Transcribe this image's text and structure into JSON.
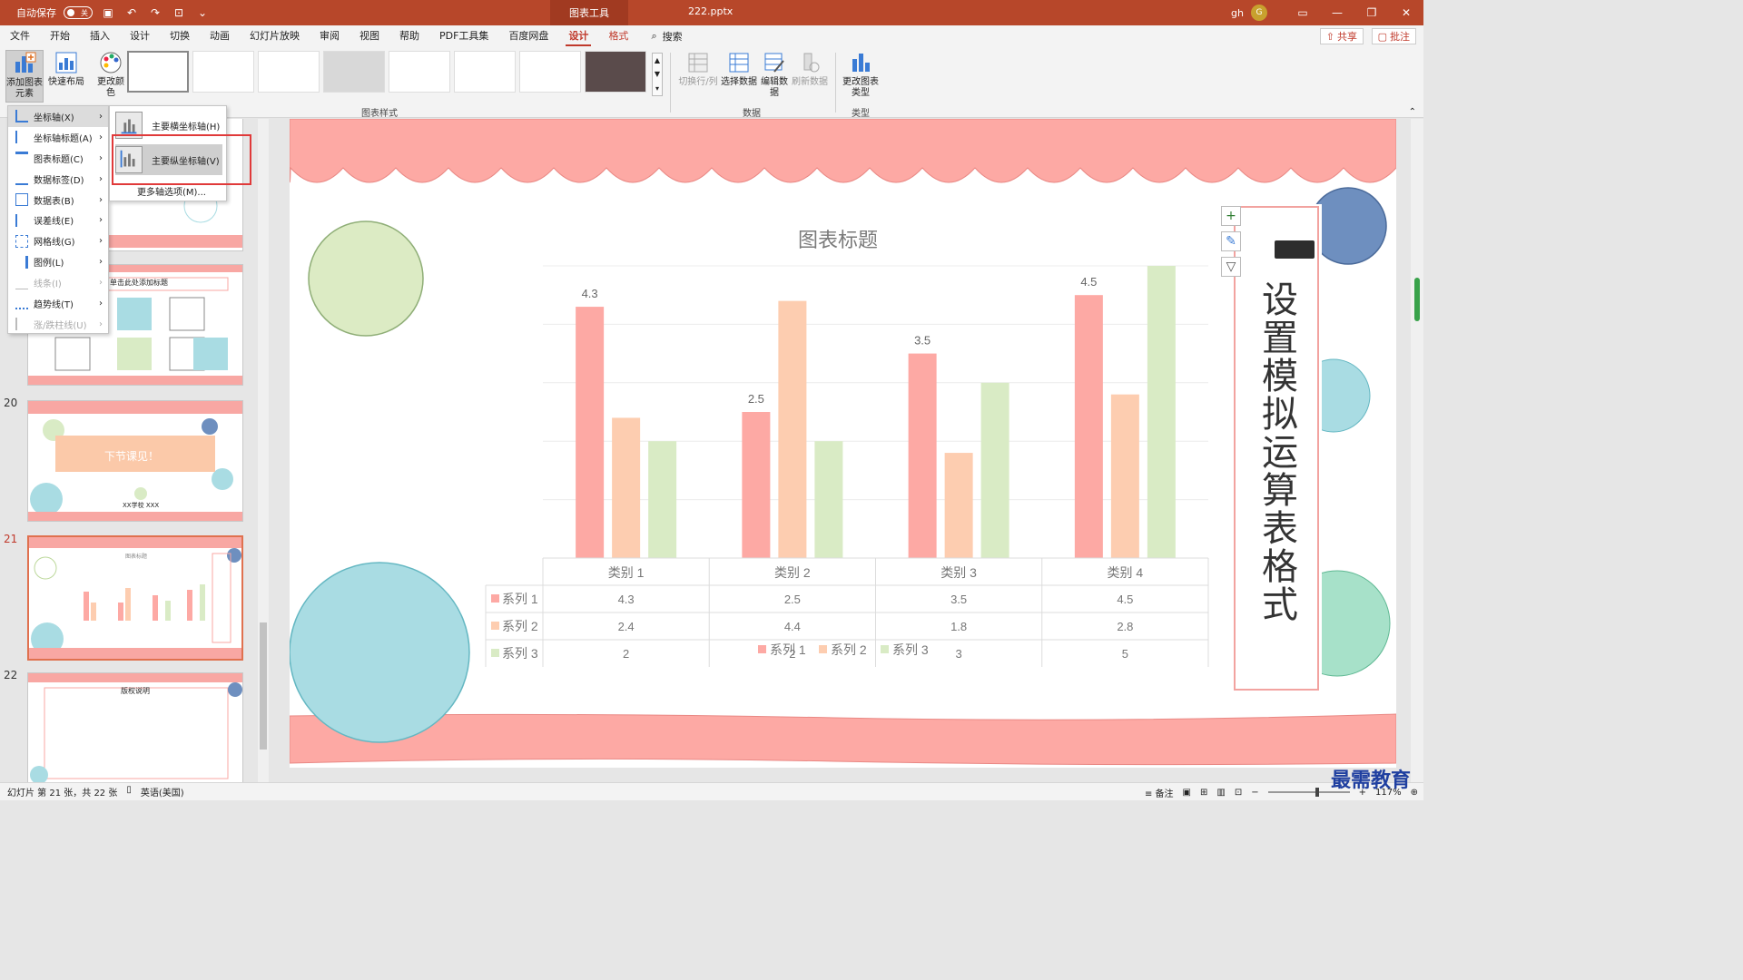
{
  "titlebar": {
    "autosave": "自动保存",
    "autosave_state": "关",
    "context_tab": "图表工具",
    "filename": "222.pptx",
    "user": "gh",
    "avatar": "G"
  },
  "menu": {
    "items": [
      "文件",
      "开始",
      "插入",
      "设计",
      "切换",
      "动画",
      "幻灯片放映",
      "审阅",
      "视图",
      "帮助",
      "PDF工具集",
      "百度网盘",
      "设计",
      "格式"
    ],
    "search": "搜索",
    "share": "共享",
    "comment": "批注"
  },
  "ribbon": {
    "add_element": "添加图表元素",
    "quick_layout": "快速布局",
    "change_color": "更改颜色",
    "styles_group": "图表样式",
    "switch_row_col": "切换行/列",
    "select_data": "选择数据",
    "edit_data": "编辑数据",
    "refresh_data": "刷新数据",
    "data_group": "数据",
    "change_type": "更改图表类型",
    "type_group": "类型"
  },
  "dropdown": {
    "items": [
      {
        "label": "坐标轴(X)",
        "disabled": false
      },
      {
        "label": "坐标轴标题(A)",
        "disabled": false
      },
      {
        "label": "图表标题(C)",
        "disabled": false
      },
      {
        "label": "数据标签(D)",
        "disabled": false
      },
      {
        "label": "数据表(B)",
        "disabled": false
      },
      {
        "label": "误差线(E)",
        "disabled": false
      },
      {
        "label": "网格线(G)",
        "disabled": false
      },
      {
        "label": "图例(L)",
        "disabled": false
      },
      {
        "label": "线条(I)",
        "disabled": true
      },
      {
        "label": "趋势线(T)",
        "disabled": false
      },
      {
        "label": "涨/跌柱线(U)",
        "disabled": true
      }
    ],
    "submenu": {
      "horizontal": "主要横坐标轴(H)",
      "vertical": "主要纵坐标轴(V)",
      "more": "更多轴选项(M)..."
    }
  },
  "thumbnails": {
    "numbers": [
      "20",
      "21",
      "22"
    ],
    "slide19_title": "单击此处添加标题",
    "slide20_text": "下节课见！",
    "slide20_sub": "XX学校  XXX",
    "slide21_title": "图表标题",
    "slide22_title": "版权说明"
  },
  "slide": {
    "vertical_title": "设置模拟运算表格式",
    "chart_data": {
      "type": "bar",
      "title": "图表标题",
      "categories": [
        "类别 1",
        "类别 2",
        "类别 3",
        "类别 4"
      ],
      "series": [
        {
          "name": "系列 1",
          "values": [
            4.3,
            2.5,
            3.5,
            4.5
          ],
          "color": "#fda9a4"
        },
        {
          "name": "系列 2",
          "values": [
            2.4,
            4.4,
            1.8,
            2.8
          ],
          "color": "#fdcdb0"
        },
        {
          "name": "系列 3",
          "values": [
            2,
            2,
            3,
            5
          ],
          "color": "#d9ebc5"
        }
      ],
      "data_labels_series": 0,
      "ylim": [
        0,
        5
      ],
      "grid": true,
      "legend": "bottom",
      "data_table": true
    }
  },
  "statusbar": {
    "slide_info": "幻灯片 第 21 张，共 22 张",
    "language": "英语(美国)",
    "notes": "备注",
    "zoom": "117%"
  },
  "watermark": "最需教育",
  "colors": {
    "accent": "#b7472a",
    "pink": "#f8a7a3",
    "green": "#d9ebc5",
    "blue": "#6e8fbf",
    "cyan": "#a9dce3"
  }
}
